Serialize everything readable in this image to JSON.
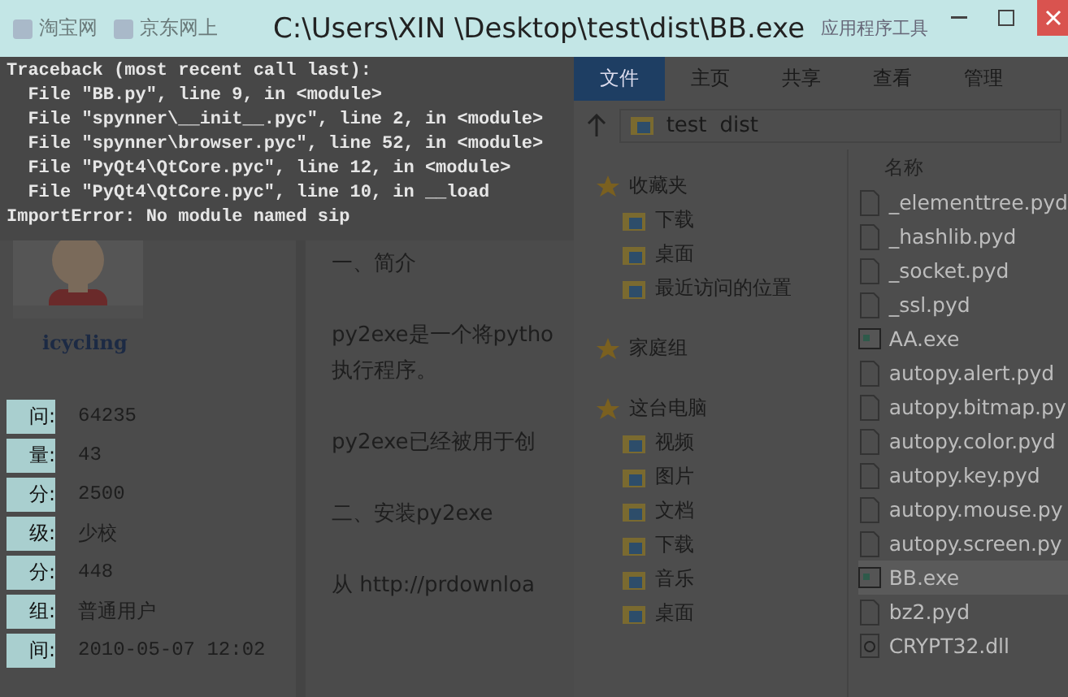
{
  "window": {
    "title": "C:\\Users\\XIN \\Desktop\\test\\dist\\BB.exe",
    "context_tab": "应用程序工具"
  },
  "bookmarks": [
    "淘宝网",
    "京东网上"
  ],
  "console": {
    "lines": [
      "Traceback (most recent call last):",
      "  File \"BB.py\", line 9, in <module>",
      "  File \"spynner\\__init__.pyc\", line 2, in <module>",
      "  File \"spynner\\browser.pyc\", line 52, in <module>",
      "  File \"PyQt4\\QtCore.pyc\", line 12, in <module>",
      "  File \"PyQt4\\QtCore.pyc\", line 10, in __load",
      "ImportError: No module named sip"
    ]
  },
  "profile": {
    "name": "icycling",
    "stats": [
      {
        "label": "问:",
        "value": "64235"
      },
      {
        "label": "量:",
        "value": "43"
      },
      {
        "label": "分:",
        "value": "2500"
      },
      {
        "label": "级:",
        "value": "少校"
      },
      {
        "label": "分:",
        "value": "448"
      },
      {
        "label": "组:",
        "value": "普通用户"
      },
      {
        "label": "间:",
        "value": "2010-05-07 12:02"
      }
    ]
  },
  "article": {
    "paragraphs": [
      "一、简介",
      "py2exe是一个将pytho\n执行程序。",
      "py2exe已经被用于创",
      "二、安装py2exe",
      "从 http://prdownloa"
    ]
  },
  "explorer": {
    "ribbon_tabs": [
      {
        "label": "文件",
        "selected": true
      },
      {
        "label": "主页",
        "selected": false
      },
      {
        "label": "共享",
        "selected": false
      },
      {
        "label": "查看",
        "selected": false
      },
      {
        "label": "管理",
        "selected": false
      }
    ],
    "path": [
      "test",
      "dist"
    ],
    "nav": [
      {
        "label": "收藏夹",
        "children": [
          {
            "label": "下载"
          },
          {
            "label": "桌面"
          },
          {
            "label": "最近访问的位置"
          }
        ]
      },
      {
        "label": "家庭组"
      },
      {
        "label": "这台电脑",
        "children": [
          {
            "label": "视频"
          },
          {
            "label": "图片"
          },
          {
            "label": "文档"
          },
          {
            "label": "下载"
          },
          {
            "label": "音乐"
          },
          {
            "label": "桌面"
          }
        ]
      }
    ],
    "column": "名称",
    "files": [
      {
        "name": "_elementtree.pyd",
        "kind": "file",
        "selected": false
      },
      {
        "name": "_hashlib.pyd",
        "kind": "file",
        "selected": false
      },
      {
        "name": "_socket.pyd",
        "kind": "file",
        "selected": false
      },
      {
        "name": "_ssl.pyd",
        "kind": "file",
        "selected": false
      },
      {
        "name": "AA.exe",
        "kind": "exe",
        "selected": false
      },
      {
        "name": "autopy.alert.pyd",
        "kind": "file",
        "selected": false
      },
      {
        "name": "autopy.bitmap.py",
        "kind": "file",
        "selected": false
      },
      {
        "name": "autopy.color.pyd",
        "kind": "file",
        "selected": false
      },
      {
        "name": "autopy.key.pyd",
        "kind": "file",
        "selected": false
      },
      {
        "name": "autopy.mouse.py",
        "kind": "file",
        "selected": false
      },
      {
        "name": "autopy.screen.py",
        "kind": "file",
        "selected": false
      },
      {
        "name": "BB.exe",
        "kind": "exe",
        "selected": true
      },
      {
        "name": "bz2.pyd",
        "kind": "file",
        "selected": false
      },
      {
        "name": "CRYPT32.dll",
        "kind": "dll",
        "selected": false
      }
    ]
  }
}
